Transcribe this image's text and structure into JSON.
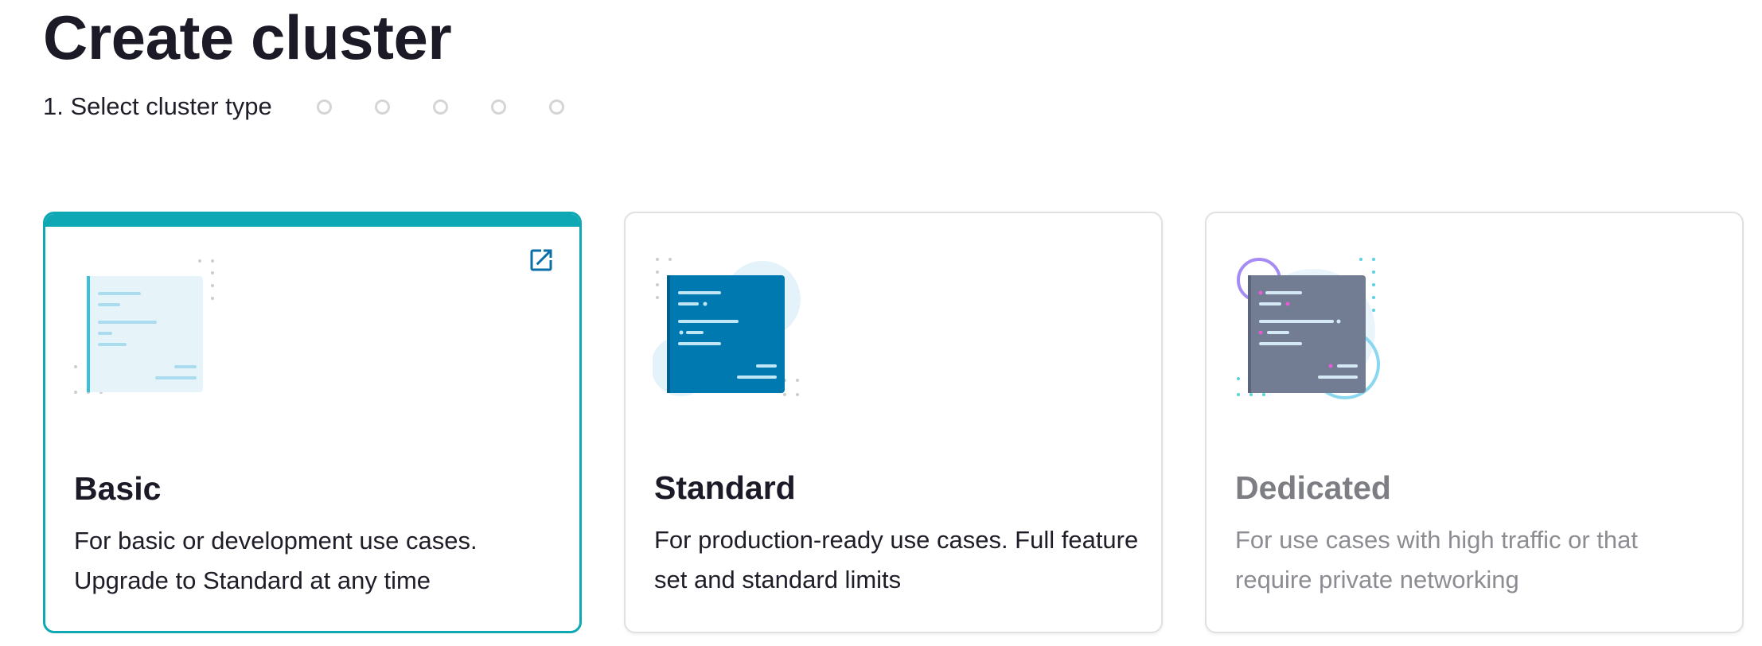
{
  "page": {
    "title": "Create cluster"
  },
  "stepper": {
    "current_step_label": "1. Select cluster type",
    "remaining_steps": 5
  },
  "cards": [
    {
      "id": "basic",
      "title": "Basic",
      "description": "For basic or development use cases. Upgrade to Standard at any time",
      "selected": true,
      "disabled": false,
      "icon": "external-link-icon"
    },
    {
      "id": "standard",
      "title": "Standard",
      "description": "For production-ready use cases. Full feature set and standard limits",
      "selected": false,
      "disabled": false
    },
    {
      "id": "dedicated",
      "title": "Dedicated",
      "description": "For use cases with high traffic or that require private networking",
      "selected": false,
      "disabled": true
    }
  ],
  "colors": {
    "accent": "#0ea8b4",
    "link_icon": "#0a6ea8",
    "standard_doc": "#0079b0",
    "dedicated_doc": "#727d94",
    "basic_doc": "#e6f4fa"
  }
}
